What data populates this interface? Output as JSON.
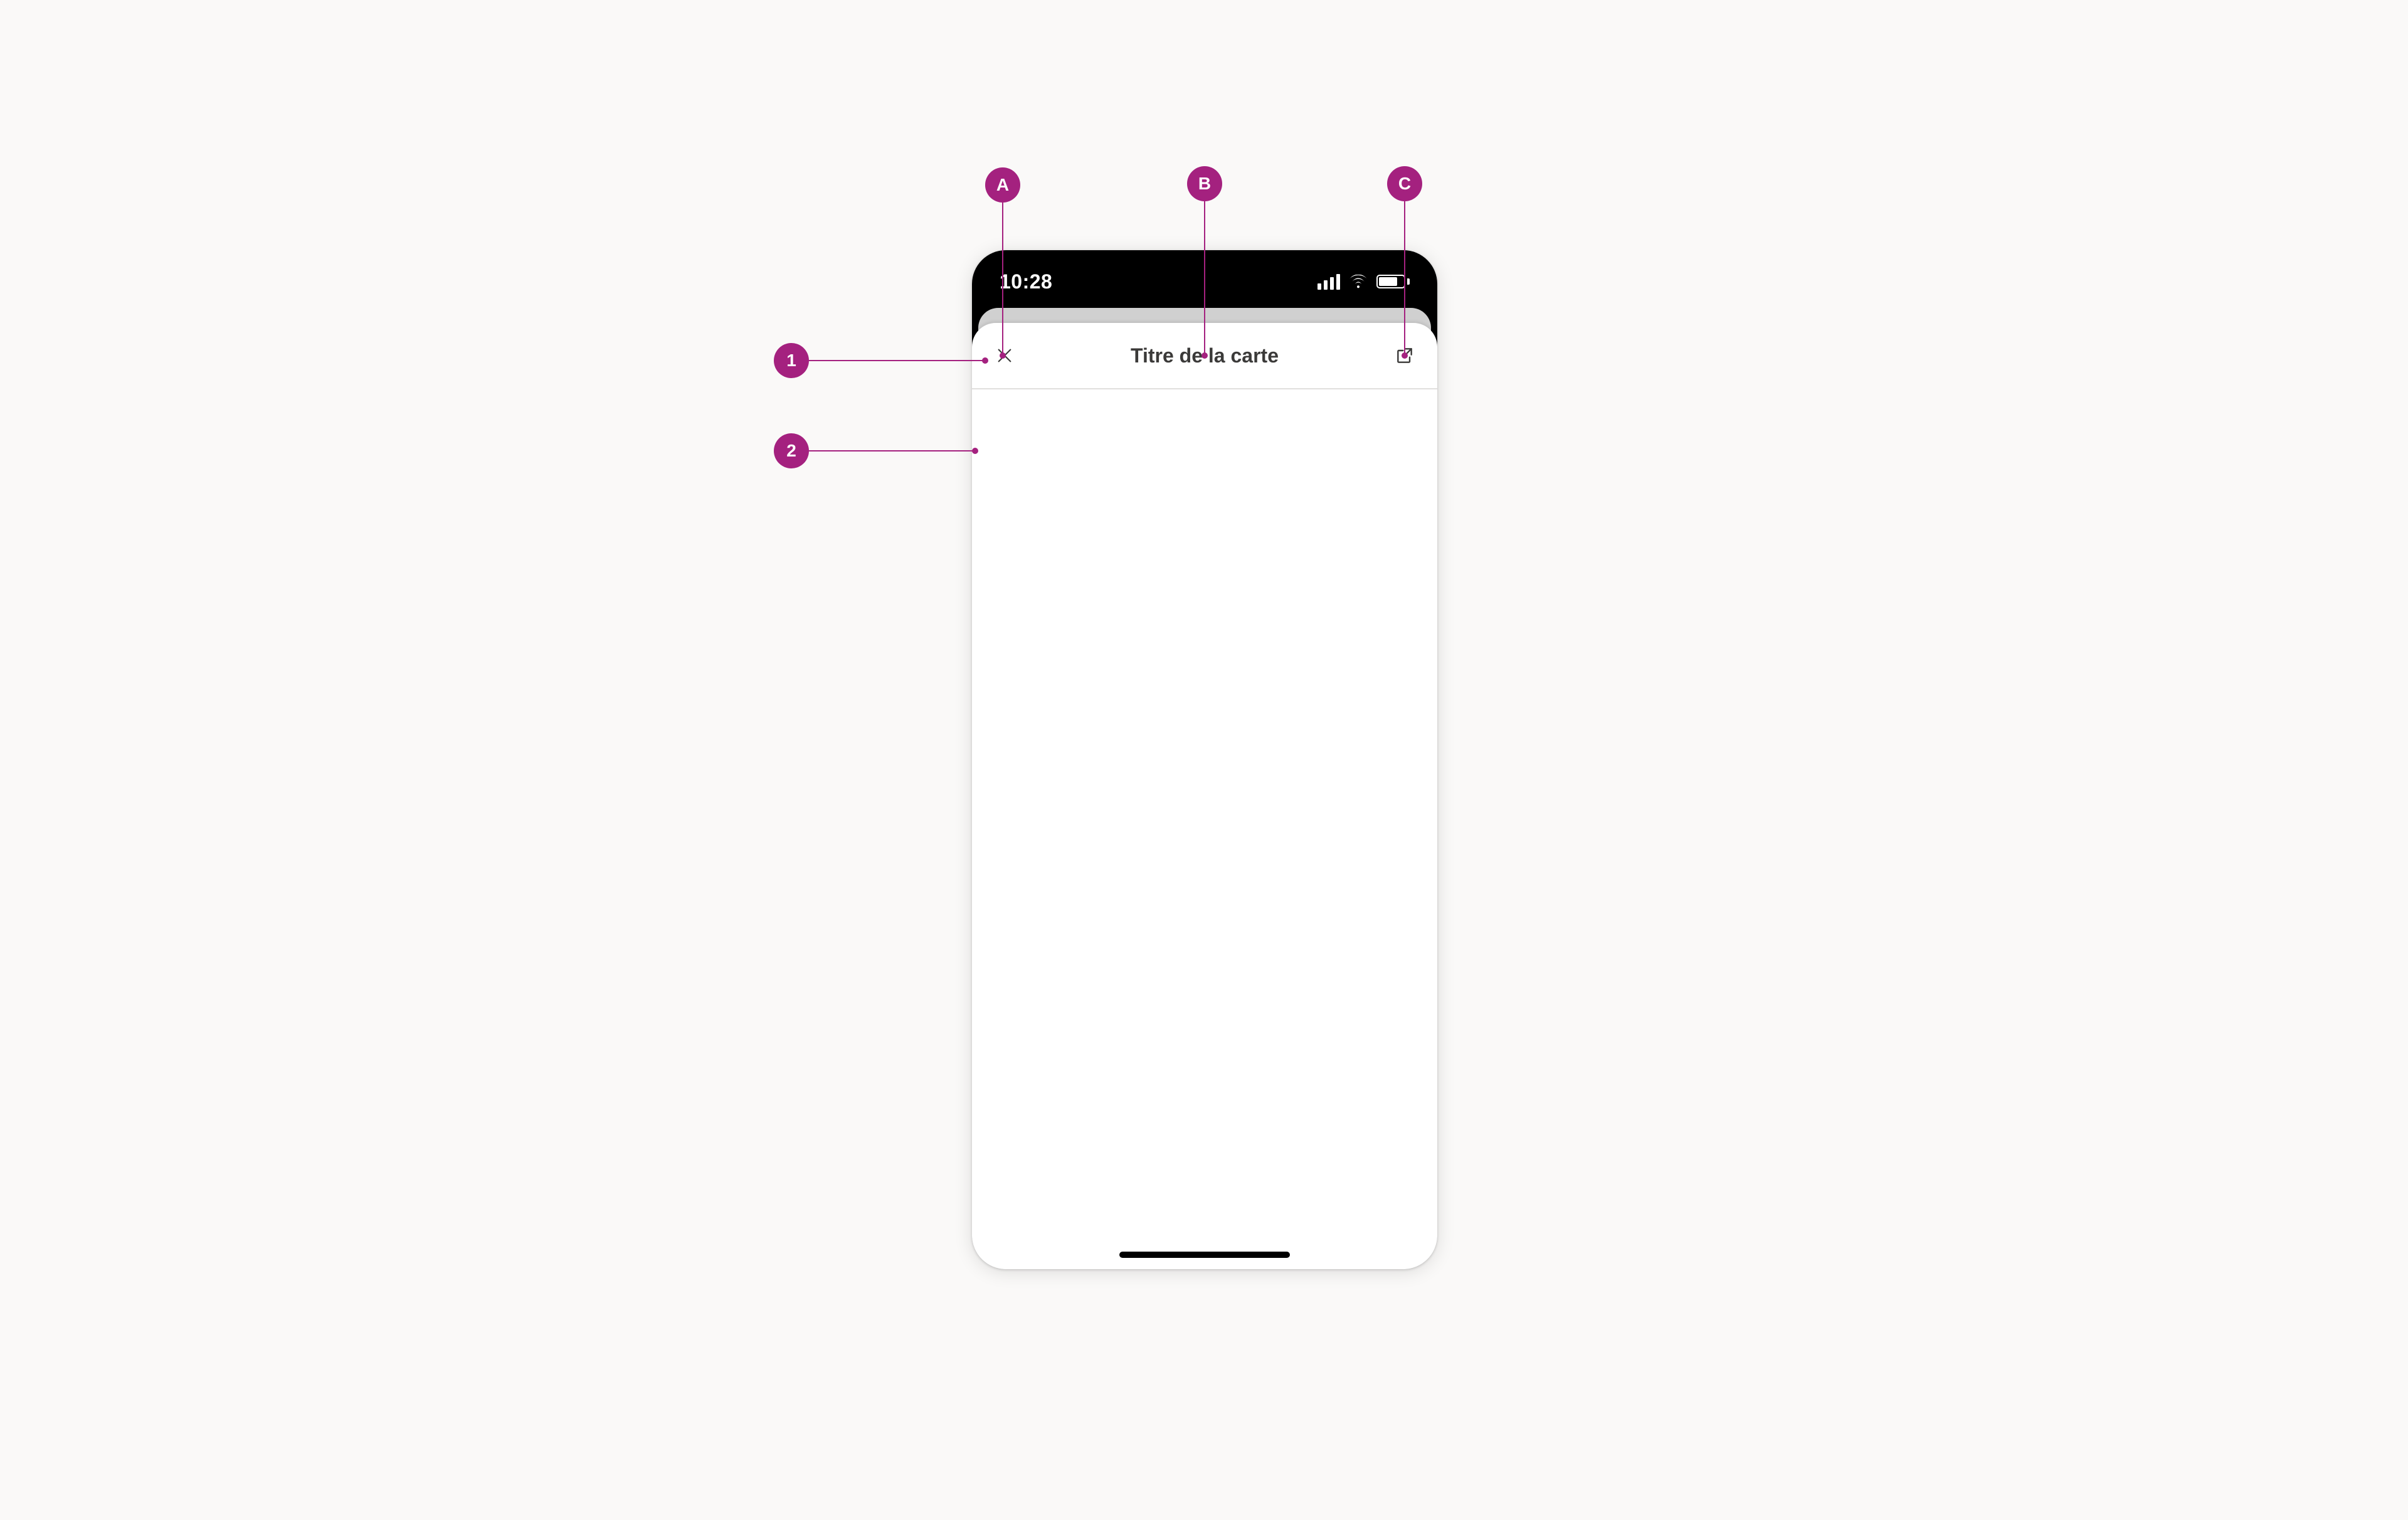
{
  "colors": {
    "accent": "#a4217f",
    "background": "#faf9f8"
  },
  "statusbar": {
    "time": "10:28"
  },
  "card": {
    "title": "Titre de la carte",
    "close_icon": "close-icon",
    "action_icon": "external-link-icon"
  },
  "callouts": {
    "letters": [
      {
        "id": "A"
      },
      {
        "id": "B"
      },
      {
        "id": "C"
      }
    ],
    "numbers": [
      {
        "id": "1"
      },
      {
        "id": "2"
      }
    ]
  }
}
